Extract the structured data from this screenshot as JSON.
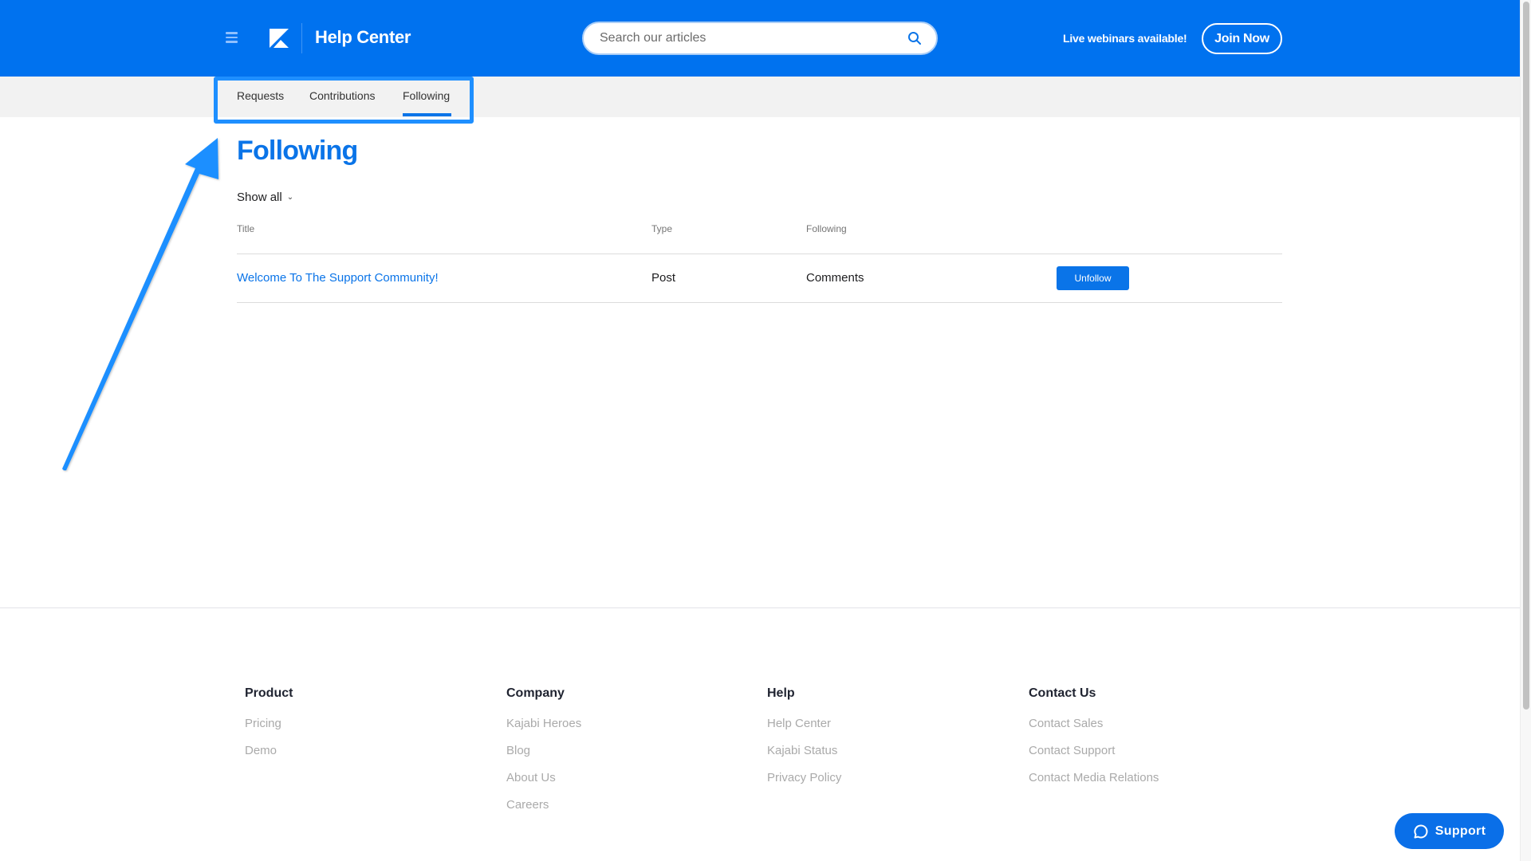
{
  "header": {
    "menu_icon": "hamburger-icon",
    "logo_icon": "kajabi-logo-icon",
    "title": "Help Center",
    "search": {
      "placeholder": "Search our articles",
      "value": "",
      "icon": "search-icon"
    },
    "promo_text": "Live webinars available!",
    "join_label": "Join Now"
  },
  "subnav": {
    "tabs": [
      {
        "label": "Requests",
        "active": false
      },
      {
        "label": "Contributions",
        "active": false
      },
      {
        "label": "Following",
        "active": true
      }
    ]
  },
  "main": {
    "title": "Following",
    "filter_label": "Show all",
    "filter_icon": "chevron-down-icon",
    "columns": [
      "Title",
      "Type",
      "Following"
    ],
    "rows": [
      {
        "title": "Welcome To The Support Community!",
        "type": "Post",
        "following": "Comments",
        "action": "Unfollow"
      }
    ]
  },
  "annotation": {
    "type": "arrow",
    "color": "#1E8FFF",
    "points_to": "subnav-tabs"
  },
  "footer": {
    "columns": [
      {
        "heading": "Product",
        "links": [
          "Pricing",
          "Demo"
        ]
      },
      {
        "heading": "Company",
        "links": [
          "Kajabi Heroes",
          "Blog",
          "About Us",
          "Careers"
        ]
      },
      {
        "heading": "Help",
        "links": [
          "Help Center",
          "Kajabi Status",
          "Privacy Policy"
        ]
      },
      {
        "heading": "Contact Us",
        "links": [
          "Contact Sales",
          "Contact Support",
          "Contact Media Relations"
        ]
      }
    ]
  },
  "support_widget": {
    "label": "Support",
    "icon": "chat-bubble-icon"
  },
  "colors": {
    "brand": "#0072EF",
    "link": "#0A74E8",
    "highlight": "#1E8FFF"
  }
}
